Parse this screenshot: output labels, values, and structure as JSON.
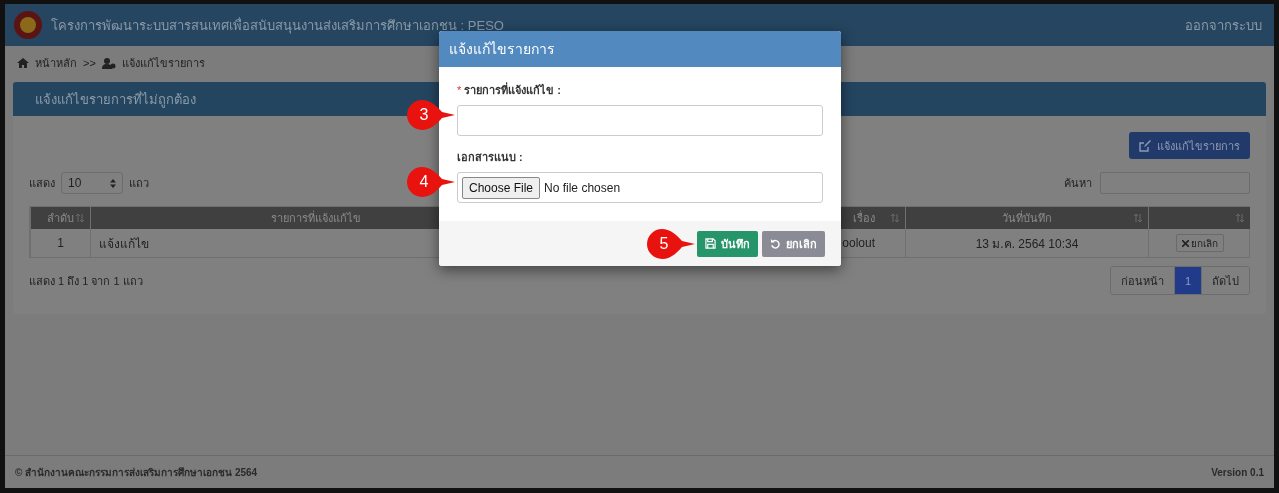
{
  "header": {
    "title": "โครงการพัฒนาระบบสารสนเทศเพื่อสนับสนุนงานส่งเสริมการศึกษาเอกชน : PESO",
    "logout": "ออกจากระบบ"
  },
  "breadcrumb": {
    "home": "หน้าหลัก",
    "separator": ">>",
    "current": "แจ้งแก้ไขรายการ"
  },
  "panel": {
    "title": "แจ้งแก้ไขรายการที่ไม่ถูกต้อง",
    "add_button": "แจ้งแก้ไขรายการ",
    "length_prefix": "แสดง",
    "length_value": "10",
    "length_suffix": "แถว",
    "search_label": "ค้นหา",
    "columns": [
      {
        "label": "ลำดับ"
      },
      {
        "label": "รายการที่แจ้งแก้ไข"
      },
      {
        "label": "เรื่อง"
      },
      {
        "label": "วันที่บันทึก"
      }
    ],
    "rows": [
      {
        "cells": [
          "1",
          "แจ้งแก้ไข",
          "oolout",
          "13 ม.ค. 2564 10:34"
        ],
        "action": "ยกเลิก"
      }
    ],
    "info": "แสดง 1 ถึง 1 จาก 1 แถว",
    "prev": "ก่อนหน้า",
    "pages": [
      {
        "label": "1",
        "selected": true
      }
    ],
    "next": "ถัดไป"
  },
  "footer": {
    "copyright": "© สำนักงานคณะกรรมการส่งเสริมการศึกษาเอกชน 2564",
    "version": "Version 0.1"
  },
  "modal": {
    "title": "แจ้งแก้ไขรายการ",
    "fields": [
      {
        "kind": "text",
        "label": "รายการที่แจ้งแก้ไข :",
        "required": true,
        "required_mark": "*",
        "callout": "3"
      },
      {
        "kind": "file",
        "label": "เอกสารแนบ :",
        "required": false,
        "button": "Choose File",
        "status": "No file chosen",
        "callout": "4"
      }
    ],
    "buttons": [
      {
        "kind": "save",
        "label": "บันทึก",
        "callout": "5"
      },
      {
        "kind": "cancel",
        "label": "ยกเลิก"
      }
    ]
  }
}
